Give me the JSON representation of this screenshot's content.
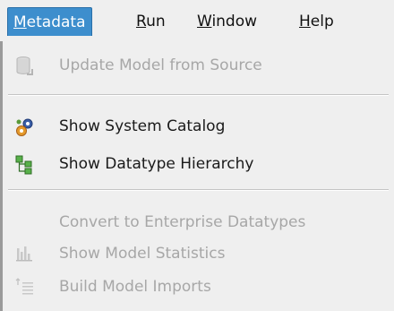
{
  "menubar": {
    "items": [
      {
        "label_mnemonic": "M",
        "label_rest": "etadata",
        "active": true
      },
      {
        "label_mnemonic": "R",
        "label_rest": "un",
        "active": false
      },
      {
        "label_mnemonic": "W",
        "label_rest": "indow",
        "active": false
      },
      {
        "label_mnemonic": "H",
        "label_rest": "elp",
        "active": false
      }
    ]
  },
  "menu": {
    "items": [
      {
        "label": "Update Model from Source",
        "icon": "database-update-icon",
        "enabled": false
      },
      {
        "label": "Show System Catalog",
        "icon": "gears-icon",
        "enabled": true
      },
      {
        "label": "Show Datatype Hierarchy",
        "icon": "hierarchy-icon",
        "enabled": true
      },
      {
        "label": "Convert to Enterprise Datatypes",
        "icon": "",
        "enabled": false
      },
      {
        "label": "Show Model Statistics",
        "icon": "bar-chart-icon",
        "enabled": false
      },
      {
        "label": "Build Model Imports",
        "icon": "import-list-icon",
        "enabled": false
      }
    ]
  },
  "colors": {
    "active_menu_bg": "#3d8ecd",
    "menu_bg": "#efefef",
    "disabled_text": "#a7a7a7"
  }
}
